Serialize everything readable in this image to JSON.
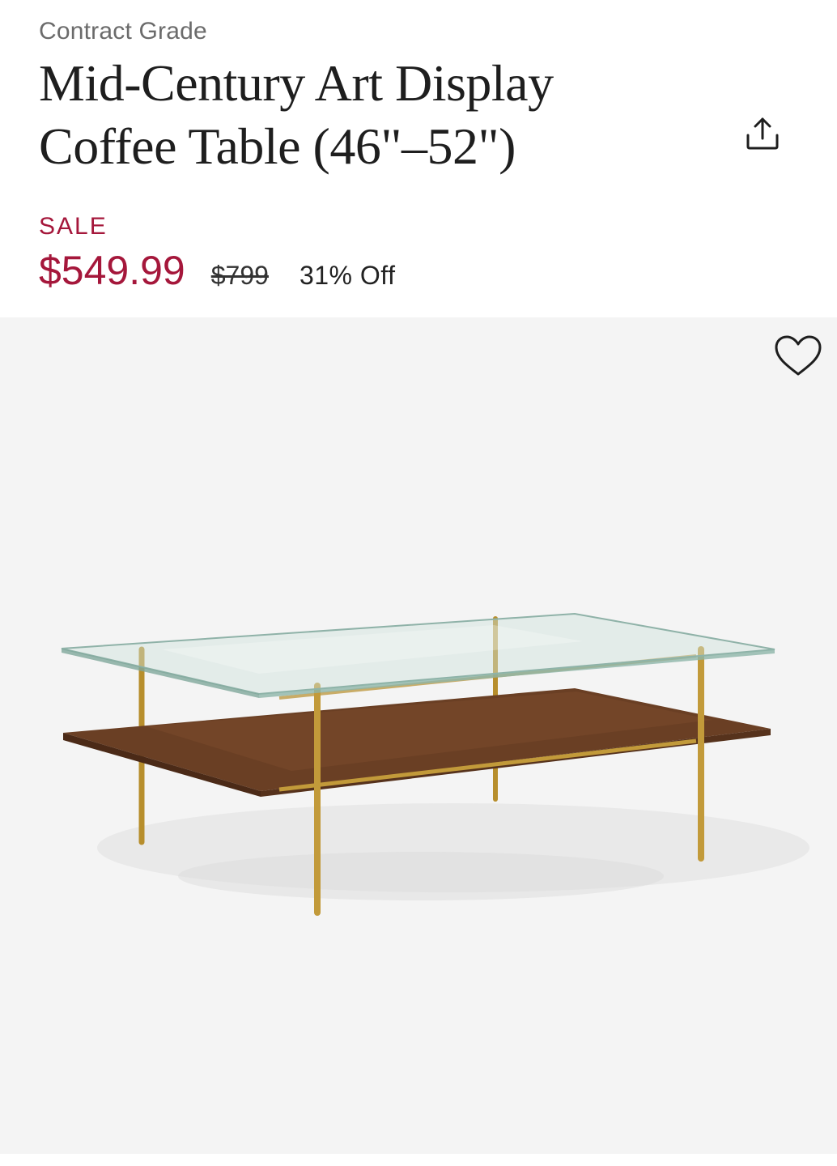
{
  "product": {
    "eyebrow": "Contract Grade",
    "title_line1": "Mid-Century Art Display",
    "title_line2": "Coffee Table (46\"–52\")"
  },
  "pricing": {
    "sale_label": "SALE",
    "sale_price": "$549.99",
    "original_price": "$799",
    "discount": "31% Off"
  },
  "icons": {
    "share": "share-icon",
    "wishlist": "heart-icon"
  },
  "colors": {
    "sale": "#a5173b",
    "title": "#1e1e1e",
    "eyebrow": "#6b6b6b",
    "image_background": "#f4f4f4"
  }
}
